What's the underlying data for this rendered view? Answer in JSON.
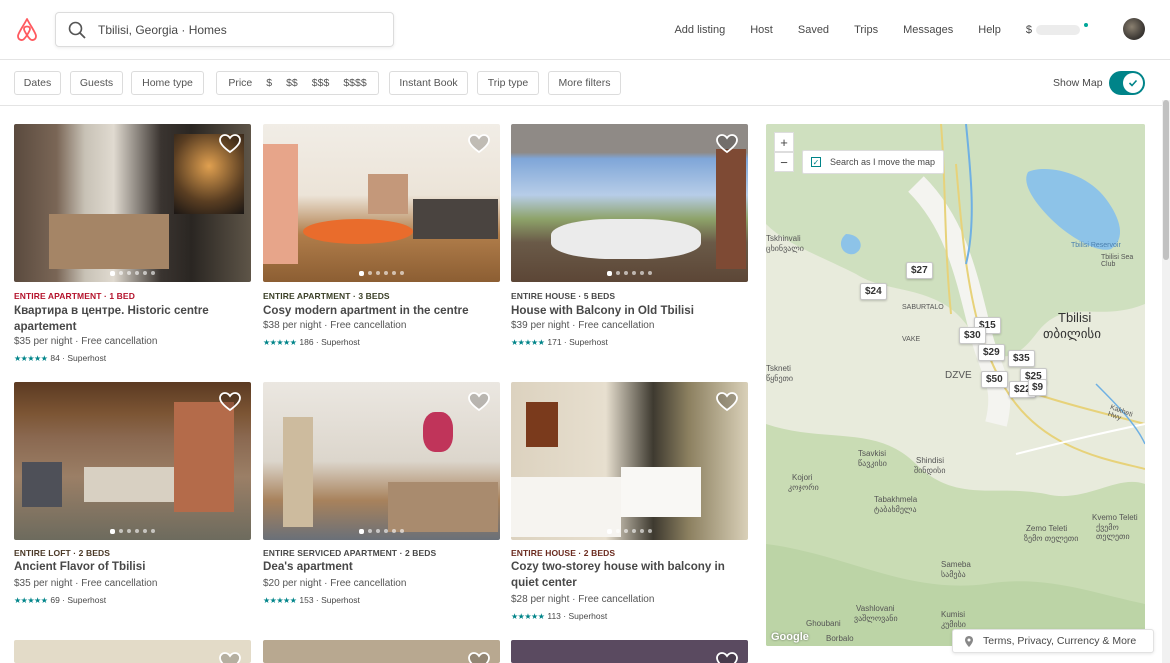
{
  "header": {
    "search_value": "Tbilisi, Georgia · Homes",
    "nav": [
      "Add listing",
      "Host",
      "Saved",
      "Trips",
      "Messages",
      "Help"
    ],
    "currency_symbol": "$",
    "brand_color": "#ff5a5f"
  },
  "filters": {
    "dates": "Dates",
    "guests": "Guests",
    "home_type": "Home type",
    "price_label": "Price",
    "price_options": [
      "$",
      "$$",
      "$$$",
      "$$$$"
    ],
    "instant_book": "Instant Book",
    "trip_type": "Trip type",
    "more_filters": "More filters",
    "show_map": "Show Map",
    "show_map_on": true
  },
  "listings": [
    {
      "type": "ENTIRE APARTMENT · 1 BED",
      "type_color": "#b4122b",
      "title": "Квартира в центре. Historic centre apartement",
      "price": "$35 per night · Free cancellation",
      "reviews": "84 · Superhost"
    },
    {
      "type": "ENTIRE APARTMENT · 3 BEDS",
      "type_color": "#3a3f26",
      "title": "Cosy modern apartment in the centre",
      "price": "$38 per night · Free cancellation",
      "reviews": "186 · Superhost"
    },
    {
      "type": "ENTIRE HOUSE · 5 BEDS",
      "type_color": "#484848",
      "title": "House with Balcony in Old Tbilisi",
      "price": "$39 per night · Free cancellation",
      "reviews": "171 · Superhost"
    },
    {
      "type": "ENTIRE LOFT · 2 BEDS",
      "type_color": "#4a3826",
      "title": "Ancient Flavor of Tbilisi",
      "price": "$35 per night · Free cancellation",
      "reviews": "69 · Superhost"
    },
    {
      "type": "ENTIRE SERVICED APARTMENT · 2 BEDS",
      "type_color": "#484848",
      "title": "Dea's apartment",
      "price": "$20 per night · Free cancellation",
      "reviews": "153 · Superhost"
    },
    {
      "type": "ENTIRE HOUSE · 2 BEDS",
      "type_color": "#6b2a1e",
      "title": "Cozy two-storey house with balcony in quiet center",
      "price": "$28 per night · Free cancellation",
      "reviews": "113 · Superhost"
    }
  ],
  "map": {
    "search_as_move": "Search as I move the map",
    "zoom_in": "+",
    "zoom_out": "−",
    "pins": [
      "$27",
      "$24",
      "$15",
      "$30",
      "$29",
      "$35",
      "$25",
      "$50",
      "$22",
      "$9"
    ],
    "labels": [
      "Tbilisi",
      "თბილისი",
      "Tbilisi Sea Club",
      "Tskhinvali",
      "ცხინვალი",
      "Tskneti",
      "წყნეთი",
      "DZVE",
      "SABURTALO",
      "VAKE",
      "Tsavkisi",
      "წავკისი",
      "Shindisi",
      "შინდისი",
      "Kojori",
      "კოჯორი",
      "Tabakhmela",
      "ტაბახმელა",
      "Zemo Teleti",
      "ზემო თელეთი",
      "Kvemo Teleti",
      "ქვემო თელეთი",
      "Sameba",
      "სამება",
      "Vashlovani",
      "ვაშლოვანი",
      "Kumisi",
      "კუმისი",
      "Ghoubani",
      "Borbalo",
      "Tbilisi Reservoir",
      "Kakheti Hwy",
      "Google"
    ],
    "terms": "Terms, Privacy, Currency & More"
  }
}
